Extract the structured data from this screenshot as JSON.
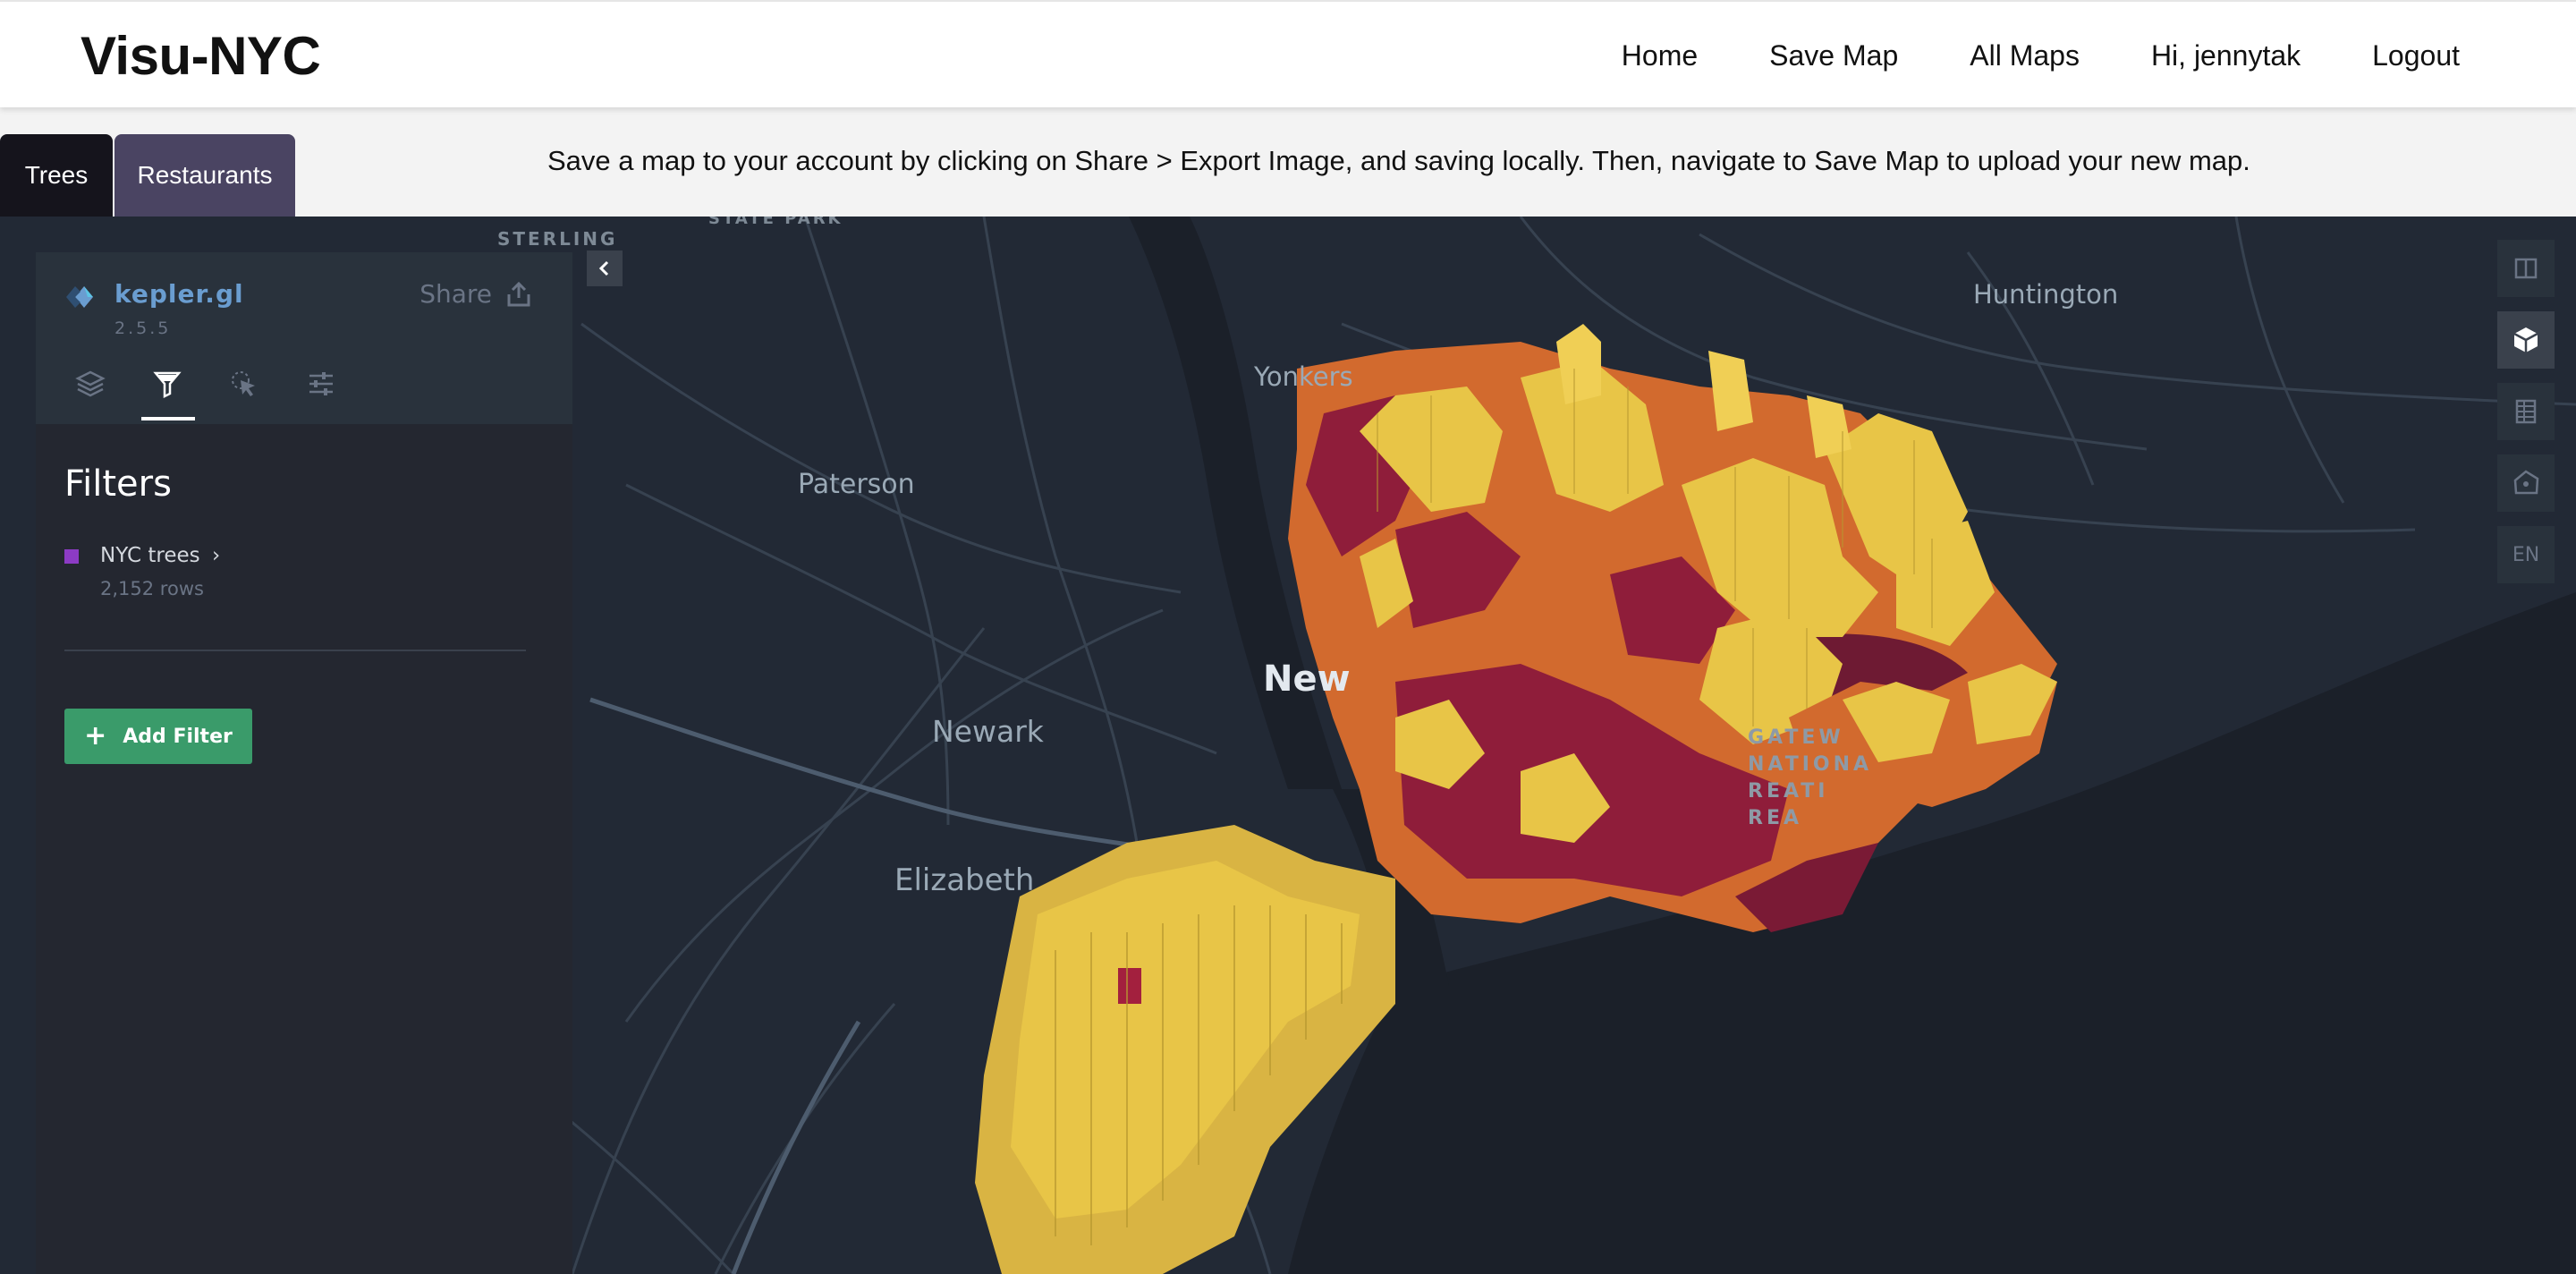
{
  "navbar": {
    "brand": "Visu-NYC",
    "links": [
      "Home",
      "Save Map",
      "All Maps",
      "Hi, jennytak",
      "Logout"
    ]
  },
  "tabs": [
    {
      "label": "Trees",
      "active": true
    },
    {
      "label": "Restaurants",
      "active": false
    }
  ],
  "notice": "Save a map to your account by clicking on Share > Export Image, and saving locally. Then, navigate to Save Map to upload your new map.",
  "kepler": {
    "name": "kepler.gl",
    "version": "2.5.5",
    "share_label": "Share",
    "panel_tabs": [
      "layers-icon",
      "filter-icon",
      "interactions-icon",
      "map-settings-icon"
    ],
    "active_panel_tab": "filter-icon"
  },
  "filters": {
    "title": "Filters",
    "dataset": {
      "name": "NYC trees",
      "rows": "2,152 rows",
      "color": "#8c3bc4"
    },
    "add_filter_label": "Add Filter"
  },
  "map": {
    "labels": {
      "paterson": "Paterson",
      "newark": "Newark",
      "elizabeth": "Elizabeth",
      "yonkers": "Yonkers",
      "huntington": "Huntington",
      "newyork": "New",
      "sterling": "STERLING\nT\nARK",
      "statepark": "STATE PARK",
      "gateway": "GATEW\nNATIONA\nREATI\nREA"
    },
    "controls": [
      "split-map-icon",
      "3d-view-icon",
      "data-table-icon",
      "draw-polygon-icon",
      "EN"
    ],
    "active_control": "3d-view-icon",
    "colors": {
      "water": "#1b2029",
      "land": "#222935",
      "extrusion_high": "#e8c547",
      "extrusion_mid": "#d26a2e",
      "extrusion_low": "#8f1d3a"
    }
  }
}
